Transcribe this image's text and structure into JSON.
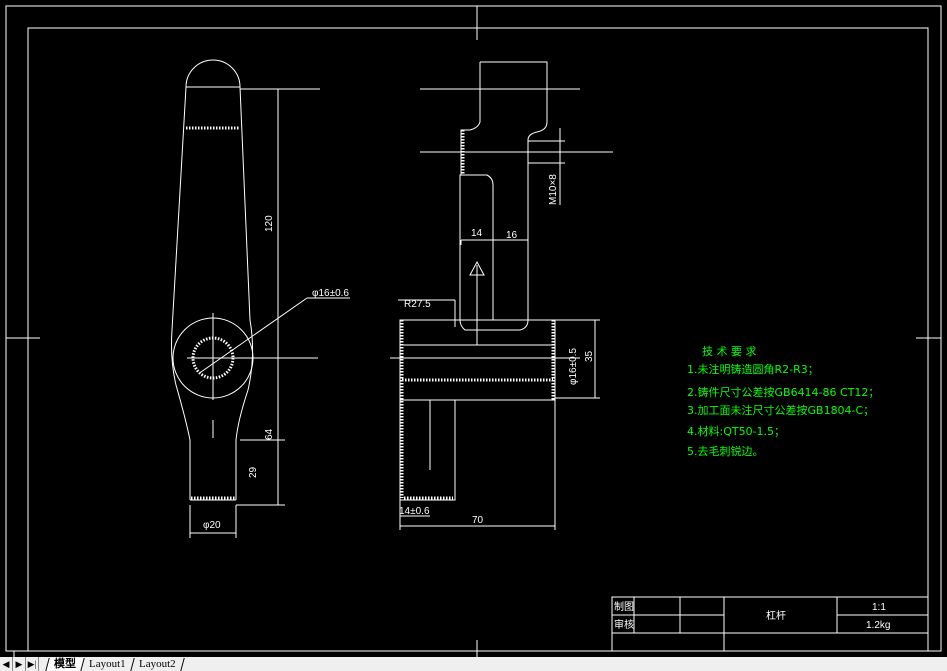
{
  "drawing": {
    "dimensions": {
      "left_length": "120",
      "left_lower": "64",
      "left_shaft": "29",
      "left_width": "φ20",
      "hole": "φ16±0.6",
      "rib_thk": "14",
      "gap": "16",
      "thread": "M10×8",
      "radius": "R27.5",
      "bore": "φ16±0.5",
      "boss_h": "35",
      "wall": "14±0.6",
      "length": "70"
    },
    "tech_requirements": {
      "title": "技 术 要 求",
      "items": [
        "1.未注明铸造圆角R2-R3；",
        "2.铸件尺寸公差按GB6414-86   CT12；",
        "3.加工面未注尺寸公差按GB1804-C；",
        "4.材料:QT50-1.5；",
        "5.去毛刺锐边。"
      ],
      "color": "#00ff00"
    },
    "title_block": {
      "drawn_label": "制图",
      "checked_label": "审核",
      "part_name": "杠杆",
      "scale": "1:1",
      "weight": "1.2kg"
    }
  },
  "tabs": {
    "nav": [
      "◀",
      "▶",
      "▶|"
    ],
    "items": [
      {
        "label": "模型",
        "active": true
      },
      {
        "label": "Layout1",
        "active": false
      },
      {
        "label": "Layout2",
        "active": false
      }
    ]
  }
}
